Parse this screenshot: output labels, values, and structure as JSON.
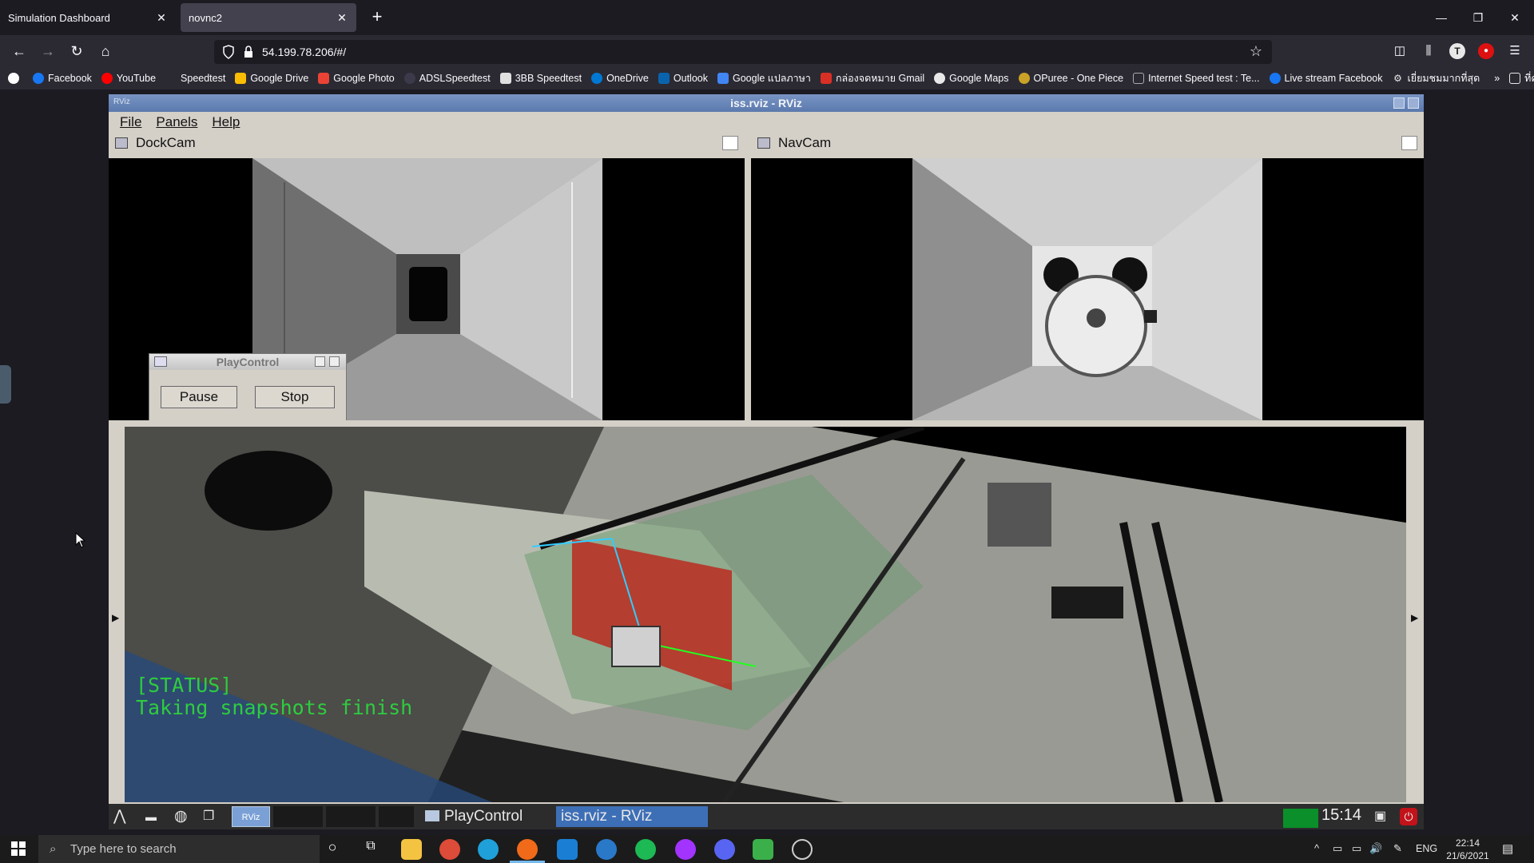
{
  "browser": {
    "tabs": [
      {
        "label": "Simulation Dashboard",
        "active": false
      },
      {
        "label": "novnc2",
        "active": true
      }
    ],
    "url": "54.199.78.206/#/",
    "bookmarks": [
      {
        "label": "Facebook",
        "color": "#1877f2"
      },
      {
        "label": "YouTube",
        "color": "#ff0000"
      },
      {
        "label": "Speedtest",
        "color": "#2b2a33"
      },
      {
        "label": "Google Drive",
        "color": "#fbbc04"
      },
      {
        "label": "Google Photo",
        "color": "#ea4335"
      },
      {
        "label": "ADSLSpeedtest",
        "color": "#3a3a4a"
      },
      {
        "label": "3BB Speedtest",
        "color": "#e0e0e0"
      },
      {
        "label": "OneDrive",
        "color": "#0078d4"
      },
      {
        "label": "Outlook",
        "color": "#0a64ad"
      },
      {
        "label": "Google แปลภาษา",
        "color": "#4285f4"
      },
      {
        "label": "กล่องจดหมาย Gmail",
        "color": "#d93025"
      },
      {
        "label": "Google Maps",
        "color": "#e8e8e8"
      },
      {
        "label": "OPuree - One Piece",
        "color": "#c9a227"
      },
      {
        "label": "Internet Speed test : Te...",
        "color": "#2b2a33"
      },
      {
        "label": "Live stream Facebook",
        "color": "#1877f2"
      },
      {
        "label": "เยี่ยมชมมากที่สุด",
        "color": "#e8e8e8"
      }
    ],
    "bookmarks_more": "ที่คั่นหน้าอื่น ๆ"
  },
  "rviz": {
    "window_title": "iss.rviz - RViz",
    "titlebar_label": "RViz",
    "menu": [
      "File",
      "Panels",
      "Help"
    ],
    "panels": {
      "dockcam": {
        "title": "DockCam"
      },
      "navcam": {
        "title": "NavCam"
      }
    },
    "status_text": "[STATUS]\nTaking snapshots finish",
    "playcontrol": {
      "title": "PlayControl",
      "pause_label": "Pause",
      "stop_label": "Stop"
    }
  },
  "remote_taskbar": {
    "items": [
      "PlayControl",
      "iss.rviz - RViz"
    ],
    "rviz_badge": "RViz",
    "clock": "15:14"
  },
  "windows_taskbar": {
    "search_placeholder": "Type here to search",
    "language": "ENG",
    "time": "22:14",
    "date": "21/6/2021"
  },
  "colors": {
    "status_green": "#2ecc40",
    "rviz_titlebar": "#5b79ad",
    "active_task": "#3d6fb6"
  }
}
